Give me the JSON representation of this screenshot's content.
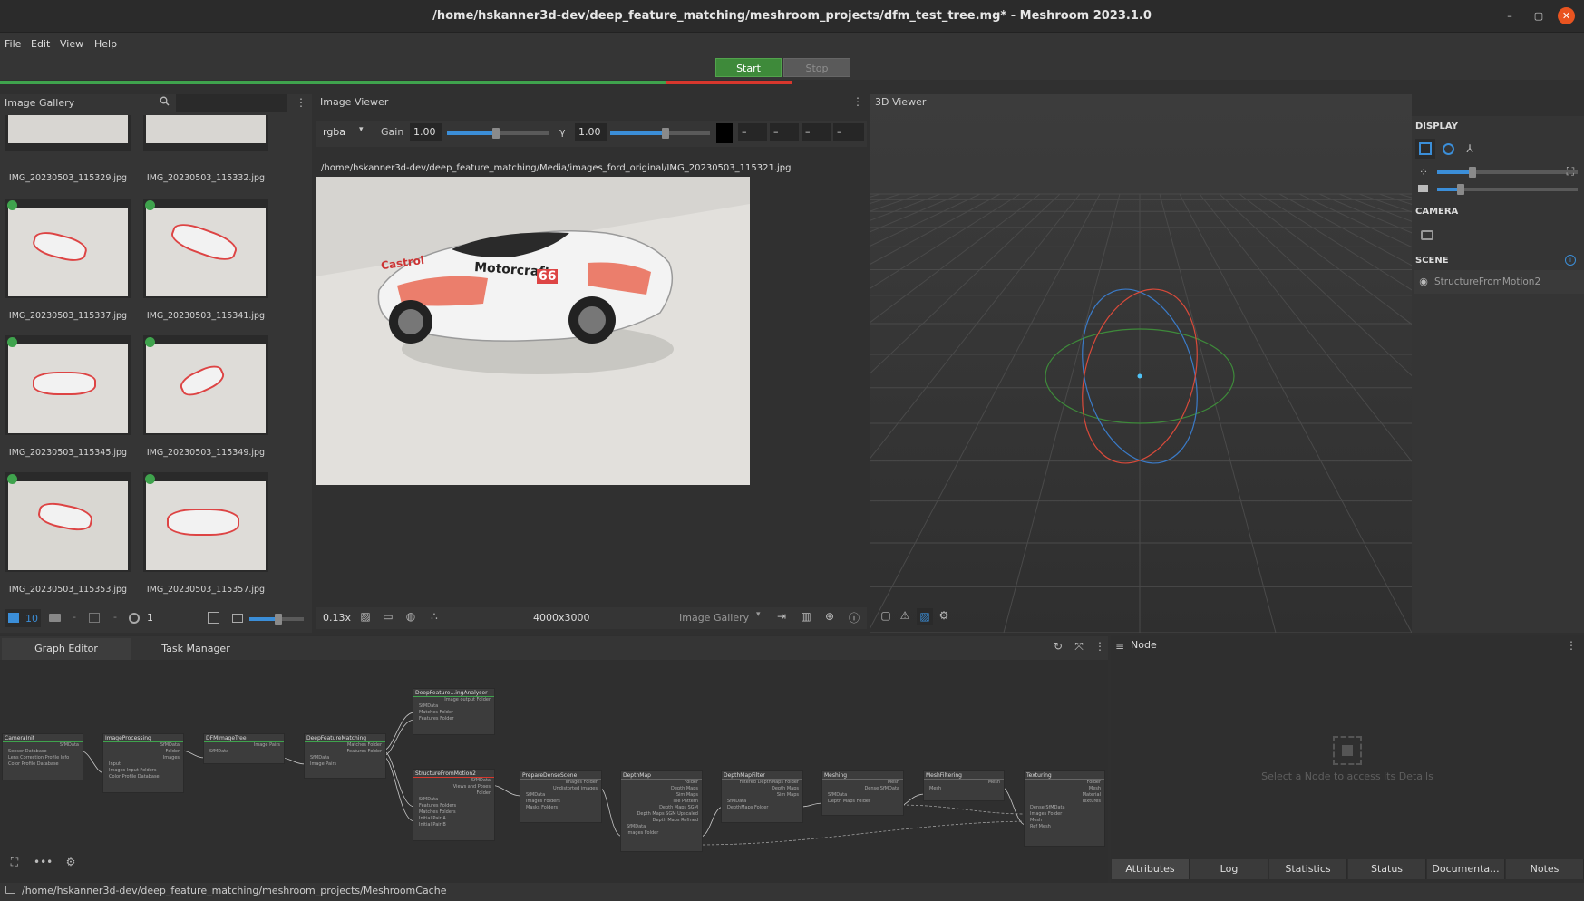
{
  "window": {
    "title": "/home/hskanner3d-dev/deep_feature_matching/meshroom_projects/dfm_test_tree.mg* - Meshroom 2023.1.0",
    "minimize": "–",
    "maximize": "▢",
    "close": "✕"
  },
  "menu": {
    "file": "File",
    "edit": "Edit",
    "view": "View",
    "help": "Help"
  },
  "toolbar": {
    "start": "Start",
    "stop": "Stop"
  },
  "progress": {
    "green_fraction": 0.42,
    "red_fraction": 0.08
  },
  "colors": {
    "accent": "#3b8ed8",
    "start": "#3e8a3a",
    "green": "#3fa34d",
    "red": "#d7372d",
    "close": "#e95420"
  },
  "gallery": {
    "title": "Image Gallery",
    "search_placeholder": "",
    "items": [
      {
        "name": "IMG_20230503_115329.jpg"
      },
      {
        "name": "IMG_20230503_115332.jpg"
      },
      {
        "name": "IMG_20230503_115337.jpg"
      },
      {
        "name": "IMG_20230503_115341.jpg"
      },
      {
        "name": "IMG_20230503_115345.jpg"
      },
      {
        "name": "IMG_20230503_115349.jpg"
      },
      {
        "name": "IMG_20230503_115353.jpg"
      },
      {
        "name": "IMG_20230503_115357.jpg"
      }
    ],
    "footer": {
      "image_count": "10",
      "dash1": "-",
      "dash2": "-",
      "intrinsics_count": "1"
    }
  },
  "image_viewer": {
    "title": "Image Viewer",
    "channel": "rgba",
    "gain_label": "Gain",
    "gain_value": "1.00",
    "gamma_label": "γ",
    "gamma_value": "1.00",
    "gain_level": 0.48,
    "gamma_level": 0.55,
    "pixel_values": [
      "–",
      "–",
      "–",
      "–"
    ],
    "path": "/home/hskanner3d-dev/deep_feature_matching/Media/images_ford_original/IMG_20230503_115321.jpg",
    "car_text_1": "Motorcraft",
    "car_text_2": "Castrol",
    "car_text_3": "66",
    "zoom": "0.13x",
    "resolution": "4000x3000",
    "source": "Image Gallery"
  },
  "viewer3d": {
    "title": "3D Viewer",
    "display_label": "DISPLAY",
    "camera_label": "CAMERA",
    "scene_label": "SCENE",
    "scene_item": "StructureFromMotion2",
    "point_size_level": 0.25,
    "camera_scale_level": 0.17
  },
  "graph": {
    "tabs": {
      "graph_editor": "Graph Editor",
      "task_manager": "Task Manager"
    },
    "nodes": [
      {
        "title": "CameraInit",
        "outputs": [
          "SfMData"
        ],
        "inputs": [
          "Sensor Database",
          "Lens Correction Profile Info",
          "Color Profile Database"
        ]
      },
      {
        "title": "ImageProcessing",
        "outputs": [
          "SfMData",
          "Folder",
          "Images"
        ],
        "inputs": [
          "Input",
          "Images Input Folders",
          "Color Profile Database"
        ]
      },
      {
        "title": "DFMImageTree",
        "outputs": [
          "Image Pairs"
        ],
        "inputs": [
          "SfMData"
        ]
      },
      {
        "title": "DeepFeatureMatching",
        "outputs": [
          "Matches Folder",
          "Features Folder"
        ],
        "inputs": [
          "SfMData",
          "Image Pairs"
        ]
      },
      {
        "title": "DeepFeature...ingAnalyser",
        "outputs": [
          "Image output Folder"
        ],
        "inputs": [
          "SfMData",
          "Matches Folder",
          "Features Folder"
        ]
      },
      {
        "title": "StructureFromMotion2",
        "outputs": [
          "SfMData",
          "Views and Poses",
          "Folder"
        ],
        "inputs": [
          "SfMData",
          "Features Folders",
          "Matches Folders",
          "Initial Pair A",
          "Initial Pair B"
        ]
      },
      {
        "title": "PrepareDenseScene",
        "outputs": [
          "Images Folder",
          "Undistorted images"
        ],
        "inputs": [
          "SfMData",
          "Images Folders",
          "Masks Folders"
        ]
      },
      {
        "title": "DepthMap",
        "outputs": [
          "Folder",
          "Depth Maps",
          "Sim Maps",
          "Tile Pattern",
          "Depth Maps SGM",
          "Depth Maps SGM Upscaled",
          "Depth Maps Refined"
        ],
        "inputs": [
          "SfMData",
          "Images Folder"
        ]
      },
      {
        "title": "DepthMapFilter",
        "outputs": [
          "Filtered DepthMaps Folder",
          "Depth Maps",
          "Sim Maps"
        ],
        "inputs": [
          "SfMData",
          "DepthMaps Folder"
        ]
      },
      {
        "title": "Meshing",
        "outputs": [
          "Mesh",
          "Dense SfMData"
        ],
        "inputs": [
          "SfMData",
          "Depth Maps Folder"
        ]
      },
      {
        "title": "MeshFiltering",
        "outputs": [
          "Mesh"
        ],
        "inputs": [
          "Mesh"
        ]
      },
      {
        "title": "Texturing",
        "outputs": [
          "Folder",
          "Mesh",
          "Material",
          "Textures"
        ],
        "inputs": [
          "Dense SfMData",
          "Images Folder",
          "Mesh",
          "Ref Mesh"
        ]
      }
    ]
  },
  "node_panel": {
    "title": "Node",
    "placeholder": "Select a Node to access its Details",
    "tabs": [
      "Attributes",
      "Log",
      "Statistics",
      "Status",
      "Documenta...",
      "Notes"
    ]
  },
  "statusbar": {
    "path": "/home/hskanner3d-dev/deep_feature_matching/meshroom_projects/MeshroomCache"
  }
}
